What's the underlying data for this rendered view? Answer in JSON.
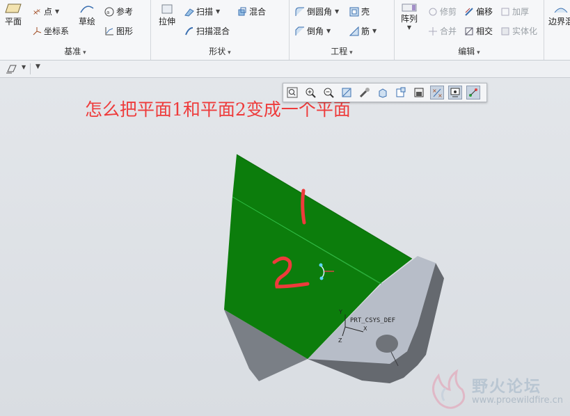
{
  "ribbon": {
    "datum": {
      "label": "基准",
      "plane": "平面",
      "point": "点",
      "csys": "坐标系",
      "sketch": "草绘",
      "reference": "参考",
      "graph": "图形"
    },
    "shapes": {
      "label": "形状",
      "extrude": "拉伸",
      "sweep": "扫描",
      "swept_blend": "扫描混合",
      "blend": "混合"
    },
    "engineering": {
      "label": "工程",
      "round": "倒圆角",
      "chamfer": "倒角",
      "shell": "壳",
      "rib": "筋"
    },
    "editing": {
      "label": "编辑",
      "pattern": "阵列",
      "trim": "修剪",
      "offset": "偏移",
      "thicken": "加厚",
      "merge": "合并",
      "intersect": "相交",
      "solidify": "实体化"
    },
    "surfaces": {
      "boundary_blend": "边界混"
    }
  },
  "viewport": {
    "question": "怎么把平面1和平面2变成一个平面",
    "label_surface_1": "1",
    "label_surface_2": "2",
    "csys_name": "PRT_CSYS_DEF",
    "axis_x": "X",
    "axis_y": "Y",
    "axis_z": "Z"
  },
  "view_toolbar": {
    "icons": [
      "refit-icon",
      "zoom-in-icon",
      "zoom-out-icon",
      "repaint-icon",
      "display-style-icon",
      "saved-orientations-icon",
      "named-views-icon",
      "section-icon",
      "perspective-icon",
      "datum-display-icon",
      "spin-center-icon",
      "annotation-display-icon"
    ]
  },
  "watermark": {
    "title": "野火论坛",
    "url": "www.proewildfire.cn"
  },
  "colors": {
    "surface_green": "#0c7d0c",
    "part_grey": "#b7bdc8",
    "part_dark": "#6d7177",
    "annotation_red": "#ee3b3b",
    "question_red": "#ee3b3b"
  }
}
